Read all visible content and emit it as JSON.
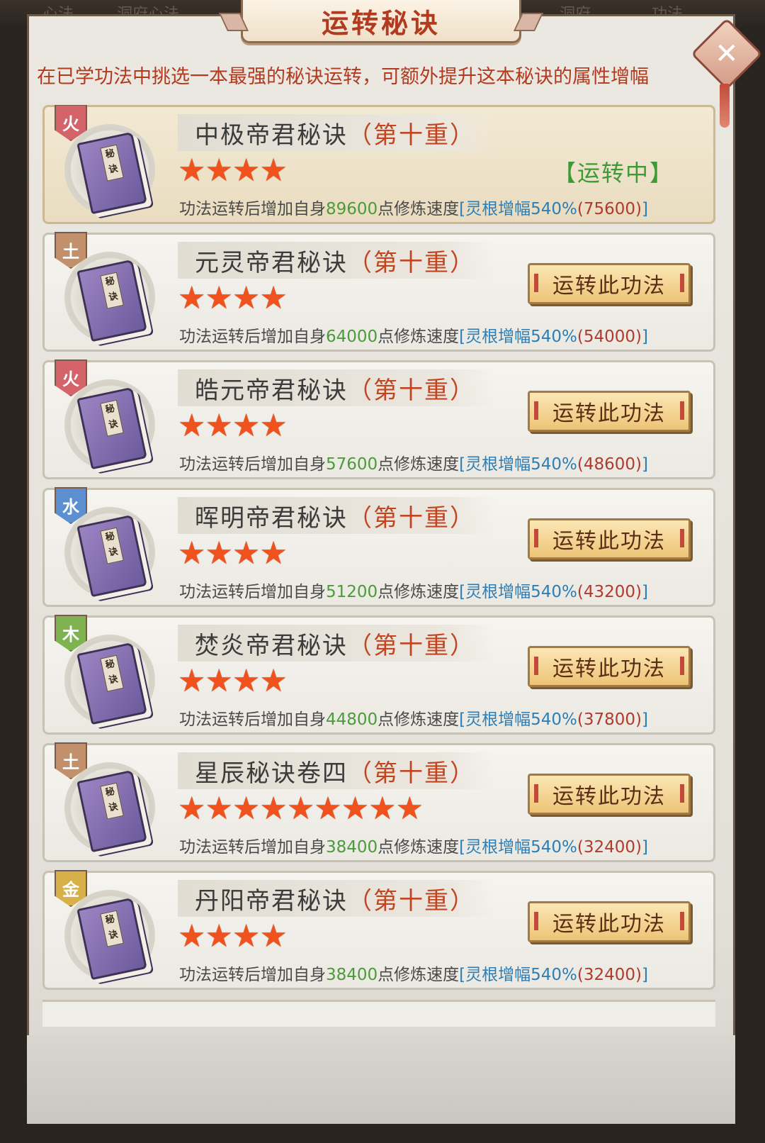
{
  "background_tabs": [
    "心法",
    "洞府心法",
    "洞府",
    "功法"
  ],
  "title": "运转秘诀",
  "hint": "在已学功法中挑选一本最强的秘诀运转，可额外提升这本秘诀的属性增幅",
  "common": {
    "layer_text": "（第十重）",
    "desc_prefix": "功法运转后增加自身",
    "desc_suffix": "点修炼速度",
    "bonus_label": "[灵根增幅540%",
    "active_status": "【运转中】",
    "run_button": "运转此功法",
    "book_glyph": "秘诀"
  },
  "colors": {
    "title_red": "#b23a1e",
    "status_green": "#3d9a35",
    "star_orange": "#f0521d",
    "bonus_blue": "#2d7eb5",
    "num_green": "#4c9b3b"
  },
  "items": [
    {
      "element": "火",
      "element_color": "#d4646a",
      "name": "中极帝君秘诀",
      "stars": 4,
      "value": "89600",
      "bonus_value": "(75600)",
      "active": true
    },
    {
      "element": "土",
      "element_color": "#c2906a",
      "name": "元灵帝君秘诀",
      "stars": 4,
      "value": "64000",
      "bonus_value": "(54000)",
      "active": false
    },
    {
      "element": "火",
      "element_color": "#d4646a",
      "name": "皓元帝君秘诀",
      "stars": 4,
      "value": "57600",
      "bonus_value": "(48600)",
      "active": false
    },
    {
      "element": "水",
      "element_color": "#5b8fd0",
      "name": "晖明帝君秘诀",
      "stars": 4,
      "value": "51200",
      "bonus_value": "(43200)",
      "active": false
    },
    {
      "element": "木",
      "element_color": "#7fb350",
      "name": "焚炎帝君秘诀",
      "stars": 4,
      "value": "44800",
      "bonus_value": "(37800)",
      "active": false
    },
    {
      "element": "土",
      "element_color": "#c2906a",
      "name": "星辰秘诀卷四",
      "stars": 9,
      "value": "38400",
      "bonus_value": "(32400)",
      "active": false
    },
    {
      "element": "金",
      "element_color": "#d8b04a",
      "name": "丹阳帝君秘诀",
      "stars": 4,
      "value": "38400",
      "bonus_value": "(32400)",
      "active": false
    }
  ]
}
